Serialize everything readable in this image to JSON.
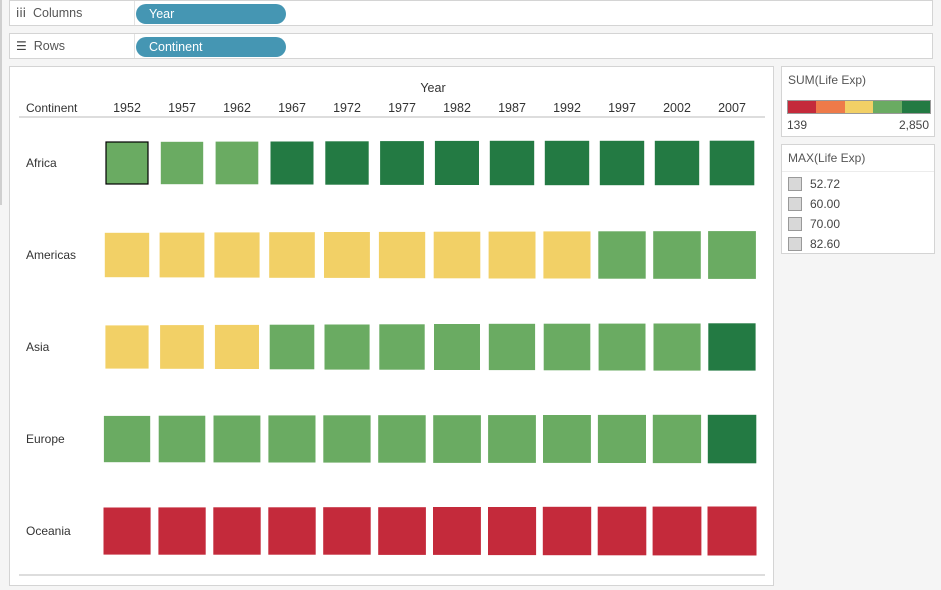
{
  "shelves": {
    "columns": {
      "label": "Columns",
      "pill": "Year"
    },
    "rows": {
      "label": "Rows",
      "pill": "Continent"
    }
  },
  "color_legend": {
    "title": "SUM(Life Exp)",
    "min_label": "139",
    "max_label": "2,850",
    "colors": [
      "#c42a3b",
      "#ee7a49",
      "#f2d066",
      "#6aab62",
      "#237a43"
    ]
  },
  "size_legend": {
    "title": "MAX(Life Exp)",
    "items": [
      "52.72",
      "60.00",
      "70.00",
      "82.60"
    ]
  },
  "chart_data": {
    "type": "heatmap",
    "mark": "square",
    "column_header": "Year",
    "row_header": "Continent",
    "x": [
      "1952",
      "1957",
      "1962",
      "1967",
      "1972",
      "1977",
      "1982",
      "1987",
      "1992",
      "1997",
      "2002",
      "2007"
    ],
    "y": [
      "Africa",
      "Americas",
      "Asia",
      "Europe",
      "Oceania"
    ],
    "color_class": [
      [
        3,
        3,
        3,
        4,
        4,
        4,
        4,
        4,
        4,
        4,
        4,
        4
      ],
      [
        2,
        2,
        2,
        2,
        2,
        2,
        2,
        2,
        2,
        3,
        3,
        3
      ],
      [
        2,
        2,
        2,
        3,
        3,
        3,
        3,
        3,
        3,
        3,
        3,
        4
      ],
      [
        3,
        3,
        3,
        3,
        3,
        3,
        3,
        3,
        3,
        3,
        3,
        4
      ],
      [
        0,
        0,
        0,
        0,
        0,
        0,
        0,
        0,
        0,
        0,
        0,
        0
      ]
    ],
    "size_value": [
      [
        39.1,
        41.3,
        43.3,
        45.3,
        47.5,
        49.6,
        51.6,
        53.3,
        53.6,
        53.6,
        53.3,
        54.8
      ],
      [
        53.3,
        55.9,
        58.4,
        60.4,
        62.4,
        64.4,
        66.2,
        68.1,
        69.6,
        71.2,
        72.4,
        73.6
      ],
      [
        46.3,
        49.3,
        51.6,
        54.7,
        57.3,
        59.6,
        62.6,
        64.9,
        66.5,
        68.0,
        69.2,
        70.7
      ],
      [
        64.4,
        66.7,
        68.5,
        69.7,
        70.8,
        71.9,
        72.8,
        73.6,
        74.4,
        75.5,
        76.7,
        77.6
      ],
      [
        69.3,
        70.3,
        71.1,
        71.3,
        71.9,
        72.9,
        74.3,
        75.3,
        76.9,
        78.2,
        79.7,
        80.7
      ]
    ],
    "highlighted": {
      "row": 0,
      "col": 0
    }
  }
}
